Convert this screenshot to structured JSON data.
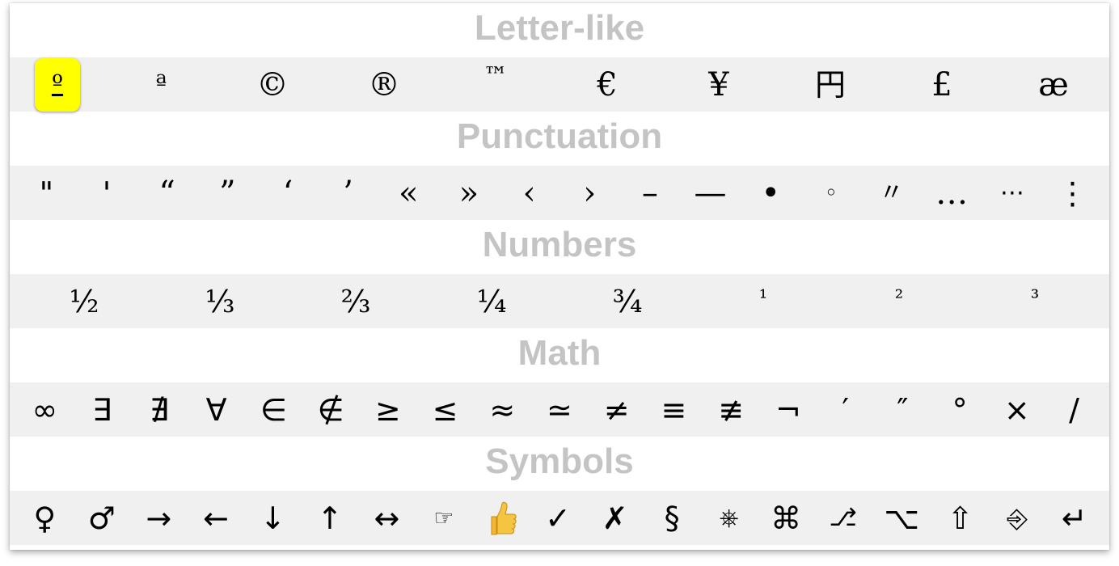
{
  "sections": [
    {
      "title": "Letter-like",
      "items": [
        "º",
        "ª",
        "©",
        "®",
        "™",
        "€",
        "¥",
        "円",
        "£",
        "æ"
      ]
    },
    {
      "title": "Punctuation",
      "items": [
        "\"",
        "'",
        "“",
        "”",
        "‘",
        "’",
        "«",
        "»",
        "‹",
        "›",
        "–",
        "—",
        "•",
        "◦",
        "〃",
        "…",
        "⋯",
        "⋮"
      ]
    },
    {
      "title": "Numbers",
      "items": [
        "½",
        "⅓",
        "⅔",
        "¼",
        "¾",
        "¹",
        "²",
        "³"
      ]
    },
    {
      "title": "Math",
      "items": [
        "∞",
        "∃",
        "∄",
        "∀",
        "∈",
        "∉",
        "≥",
        "≤",
        "≈",
        "≃",
        "≠",
        "≡",
        "≢",
        "¬",
        "′",
        "″",
        "°",
        "×",
        "/"
      ]
    },
    {
      "title": "Symbols",
      "items": [
        "♀",
        "♂",
        "→",
        "←",
        "↓",
        "↑",
        "↔",
        "☞",
        "👍",
        "✓",
        "✗",
        "§",
        "⎈",
        "⌘",
        "⎇",
        "⌥",
        "⇧",
        "⎆",
        "↵"
      ]
    }
  ],
  "selected": {
    "section": 0,
    "item": 0
  },
  "colors": {
    "header_text": "#c4c4c4",
    "row_background": "#f0f0f0",
    "selected_background": "#ffff00"
  }
}
